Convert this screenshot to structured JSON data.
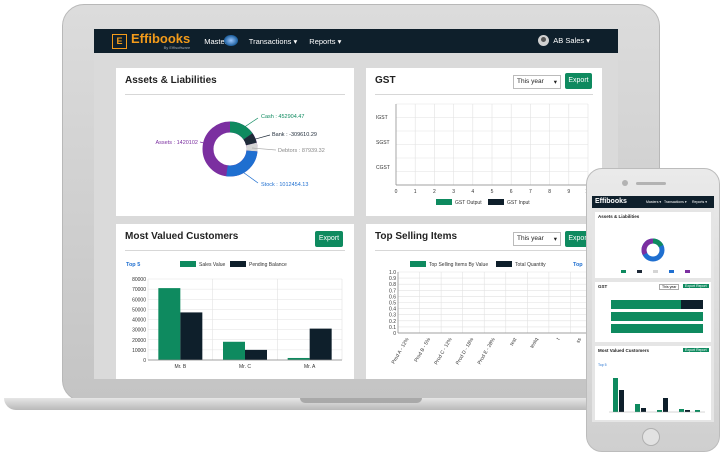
{
  "nav": {
    "brand": "Effibooks",
    "brand_sub": "By Effisoftware",
    "items": [
      "Masters ▾",
      "Transactions ▾",
      "Reports ▾"
    ],
    "user": "AB Sales ▾"
  },
  "assets": {
    "title": "Assets & Liabilities",
    "labels": {
      "cash": "Cash : 452904.47",
      "bank": "Bank : -309610.29",
      "debtors": "Debtors : 87939.32",
      "stock": "Stock : 1012454.13",
      "assets": "Assets : 1420102"
    },
    "colors": {
      "assets": "#7b2fa0",
      "cash": "#0e8a5f",
      "bank": "#1e2a38",
      "debtors": "#d5d5d5",
      "stock": "#1f6fd0"
    }
  },
  "gst": {
    "title": "GST",
    "period": "This year",
    "export": "Export",
    "categories": [
      "IGST",
      "SGST",
      "CGST"
    ],
    "x_ticks": [
      "0",
      "1",
      "2",
      "3",
      "4",
      "5",
      "6",
      "7",
      "8",
      "9",
      "10"
    ],
    "legend": [
      "GST Output",
      "GST Input"
    ],
    "colors": {
      "output": "#0e8a5f",
      "input": "#0e1f2b"
    }
  },
  "customers": {
    "title": "Most Valued Customers",
    "export": "Export",
    "top": "Top 5",
    "legend": [
      "Sales Value",
      "Pending Balance"
    ]
  },
  "selling": {
    "title": "Top Selling Items",
    "period": "This year",
    "export": "Export",
    "top": "Top",
    "legend": [
      "Top Selling Items By Value",
      "Total Quantity"
    ],
    "y_ticks": [
      "1.0",
      "0.9",
      "0.8",
      "0.7",
      "0.6",
      "0.5",
      "0.4",
      "0.3",
      "0.2",
      "0.1",
      "0"
    ],
    "categories": [
      "Prod A - 12%",
      "Prod B - 5%",
      "Prod C - 12%",
      "Prod D - 18%",
      "Prod E - 28%",
      "test",
      "testq",
      "t",
      "ss"
    ]
  },
  "phone": {
    "brand": "Effibooks",
    "nav": [
      "Masters ▾",
      "Transactions ▾",
      "Reports ▾"
    ],
    "assets_title": "Assets & Liabilities",
    "gst_title": "GST",
    "period": "This year",
    "export": "Export Report",
    "customers_title": "Most Valued Customers",
    "customers_top": "Top 5"
  },
  "chart_data": [
    {
      "type": "bar",
      "title": "Most Valued Customers",
      "categories": [
        "Mr. B",
        "Mr. C",
        "Mr. A"
      ],
      "series": [
        {
          "name": "Sales Value",
          "values": [
            71000,
            18000,
            2000
          ]
        },
        {
          "name": "Pending Balance",
          "values": [
            47000,
            10000,
            31000
          ]
        }
      ],
      "y_ticks": [
        "80000",
        "70000",
        "60000",
        "50000",
        "40000",
        "30000",
        "20000",
        "10000",
        "0"
      ],
      "ylim": [
        0,
        80000
      ],
      "colors": [
        "#0e8a5f",
        "#0e1f2b"
      ],
      "legend": "top"
    },
    {
      "type": "pie",
      "title": "Assets & Liabilities",
      "labels": [
        "Cash",
        "Bank",
        "Debtors",
        "Stock"
      ],
      "values": [
        452904.47,
        -309610.29,
        87939.32,
        1012454.13
      ],
      "grid": false
    }
  ]
}
